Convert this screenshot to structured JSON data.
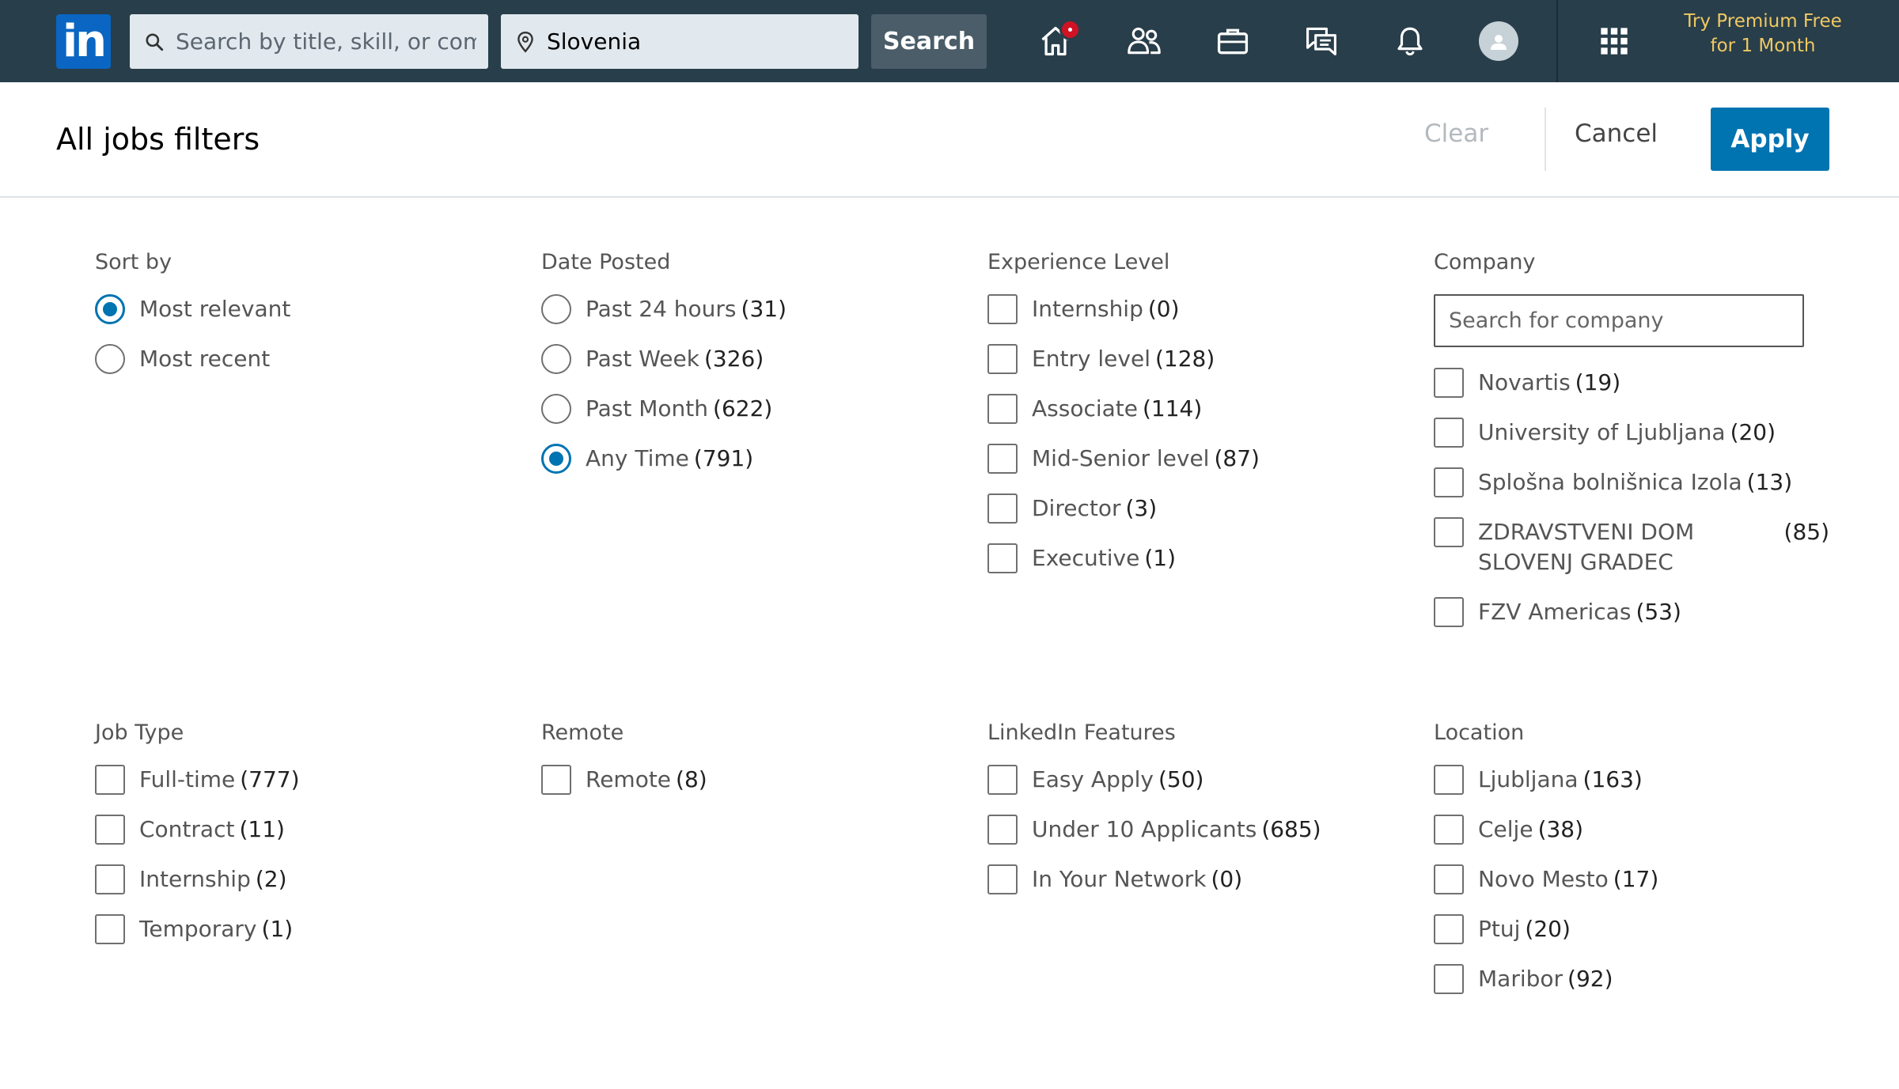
{
  "nav": {
    "logo_text": "in",
    "search_placeholder": "Search by title, skill, or company",
    "location_value": "Slovenia",
    "search_button": "Search",
    "premium_line1": "Try Premium Free",
    "premium_line2": "for 1 Month",
    "icons": [
      "home-icon",
      "my-network-icon",
      "jobs-icon",
      "messaging-icon",
      "notifications-icon",
      "profile-avatar",
      "work-grid-icon"
    ],
    "accent": "#283e4a"
  },
  "header": {
    "title": "All jobs filters",
    "clear": "Clear",
    "cancel": "Cancel",
    "apply": "Apply",
    "apply_color": "#0073b1"
  },
  "filters": {
    "sort_by": {
      "heading": "Sort by",
      "options": [
        {
          "label": "Most relevant",
          "selected": true
        },
        {
          "label": "Most recent",
          "selected": false
        }
      ]
    },
    "date_posted": {
      "heading": "Date Posted",
      "options": [
        {
          "label": "Past 24 hours",
          "count": "(31)",
          "selected": false
        },
        {
          "label": "Past Week",
          "count": "(326)",
          "selected": false
        },
        {
          "label": "Past Month",
          "count": "(622)",
          "selected": false
        },
        {
          "label": "Any Time",
          "count": "(791)",
          "selected": true
        }
      ]
    },
    "experience_level": {
      "heading": "Experience Level",
      "options": [
        {
          "label": "Internship",
          "count": "(0)"
        },
        {
          "label": "Entry level",
          "count": "(128)"
        },
        {
          "label": "Associate",
          "count": "(114)"
        },
        {
          "label": "Mid-Senior level",
          "count": "(87)"
        },
        {
          "label": "Director",
          "count": "(3)"
        },
        {
          "label": "Executive",
          "count": "(1)"
        }
      ]
    },
    "company": {
      "heading": "Company",
      "search_placeholder": "Search for company",
      "options": [
        {
          "label": "Novartis",
          "count": "(19)"
        },
        {
          "label": "University of Ljubljana",
          "count": "(20)"
        },
        {
          "label": "Splošna bolnišnica Izola",
          "count": "(13)"
        },
        {
          "label": "ZDRAVSTVENI DOM SLOVENJ GRADEC",
          "count": "(85)"
        },
        {
          "label": "FZV Americas",
          "count": "(53)"
        }
      ]
    },
    "job_type": {
      "heading": "Job Type",
      "options": [
        {
          "label": "Full-time",
          "count": "(777)"
        },
        {
          "label": "Contract",
          "count": "(11)"
        },
        {
          "label": "Internship",
          "count": "(2)"
        },
        {
          "label": "Temporary",
          "count": "(1)"
        }
      ]
    },
    "remote": {
      "heading": "Remote",
      "options": [
        {
          "label": "Remote",
          "count": "(8)"
        }
      ]
    },
    "linkedin_features": {
      "heading": "LinkedIn Features",
      "options": [
        {
          "label": "Easy Apply",
          "count": "(50)"
        },
        {
          "label": "Under 10 Applicants",
          "count": "(685)"
        },
        {
          "label": "In Your Network",
          "count": "(0)"
        }
      ]
    },
    "location": {
      "heading": "Location",
      "options": [
        {
          "label": "Ljubljana",
          "count": "(163)"
        },
        {
          "label": "Celje",
          "count": "(38)"
        },
        {
          "label": "Novo Mesto",
          "count": "(17)"
        },
        {
          "label": "Ptuj",
          "count": "(20)"
        },
        {
          "label": "Maribor",
          "count": "(92)"
        }
      ]
    }
  }
}
